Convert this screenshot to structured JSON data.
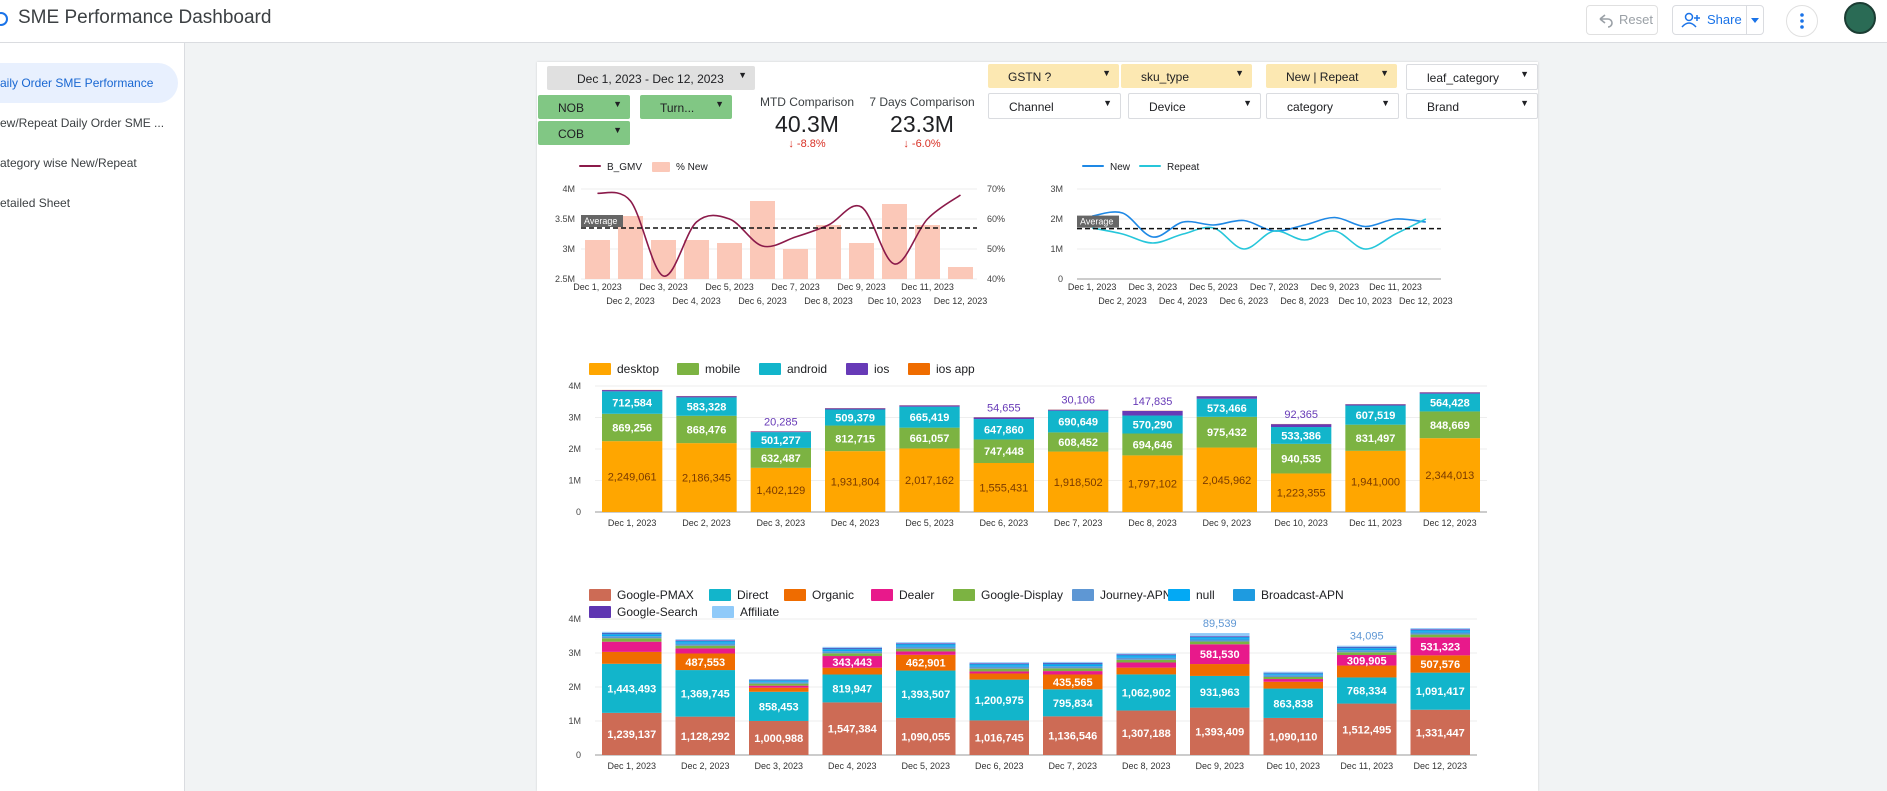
{
  "app": {
    "title": "SME Performance Dashboard",
    "reset_label": "Reset",
    "share_label": "Share"
  },
  "sidebar": {
    "items": [
      {
        "label": "aily Order SME Performance",
        "active": true
      },
      {
        "label": "ew/Repeat Daily Order SME ...",
        "active": false
      },
      {
        "label": "ategory wise New/Repeat",
        "active": false
      },
      {
        "label": "etailed Sheet",
        "active": false
      }
    ]
  },
  "filters": {
    "date_range": "Dec 1, 2023 - Dec 12, 2023",
    "nob": "NOB",
    "turn": "Turn...",
    "cob": "COB",
    "gstn": "GSTN ?",
    "sku_type": "sku_type",
    "new_repeat": "New | Repeat",
    "leaf_category": "leaf_category",
    "channel": "Channel",
    "device": "Device",
    "category": "category",
    "brand": "Brand"
  },
  "kpis": {
    "mtd_label": "MTD Comparison",
    "mtd_value": "40.3M",
    "mtd_delta": "↓ -8.8%",
    "d7_label": "7 Days Comparison",
    "d7_value": "23.3M",
    "d7_delta": "↓ -6.0%"
  },
  "colors": {
    "gmv_line": "#8b1a4a",
    "new_bar": "#fbc8b8",
    "new_line": "#1e88e5",
    "repeat_line": "#26c6da",
    "negative": "#d93025",
    "accent": "#1a73e8"
  },
  "chart_data": [
    {
      "type": "bar",
      "title": "",
      "categories": [
        "Dec 1, 2023",
        "Dec 2, 2023",
        "Dec 3, 2023",
        "Dec 4, 2023",
        "Dec 5, 2023",
        "Dec 6, 2023",
        "Dec 7, 2023",
        "Dec 8, 2023",
        "Dec 9, 2023",
        "Dec 10, 2023",
        "Dec 11, 2023",
        "Dec 12, 2023"
      ],
      "series": [
        {
          "name": "B_GMV",
          "kind": "line",
          "axis": "left",
          "values": [
            3.93,
            3.8,
            2.55,
            3.45,
            3.5,
            3.05,
            3.2,
            3.4,
            3.7,
            2.75,
            3.5,
            3.9
          ]
        },
        {
          "name": "% New",
          "kind": "bar",
          "axis": "right",
          "values": [
            53,
            61,
            53,
            53,
            52,
            66,
            50,
            58,
            52,
            65,
            58,
            44
          ]
        }
      ],
      "annotations": [
        "Average"
      ],
      "ylim_left": [
        2.5,
        4
      ],
      "ylim_right": [
        40,
        70
      ],
      "yticks_left": [
        "2.5M",
        "3M",
        "3.5M",
        "4M"
      ],
      "yticks_right": [
        "40%",
        "50%",
        "60%",
        "70%"
      ],
      "legend": "top-left"
    },
    {
      "type": "line",
      "title": "",
      "categories": [
        "Dec 1, 2023",
        "Dec 2, 2023",
        "Dec 3, 2023",
        "Dec 4, 2023",
        "Dec 5, 2023",
        "Dec 6, 2023",
        "Dec 7, 2023",
        "Dec 8, 2023",
        "Dec 9, 2023",
        "Dec 10, 2023",
        "Dec 11, 2023",
        "Dec 12, 2023"
      ],
      "series": [
        {
          "name": "New",
          "values": [
            2.1,
            2.2,
            1.4,
            1.9,
            1.8,
            1.95,
            1.6,
            1.8,
            2.05,
            1.75,
            2.0,
            1.9
          ]
        },
        {
          "name": "Repeat",
          "values": [
            1.7,
            1.5,
            1.2,
            1.5,
            1.7,
            1.0,
            1.6,
            1.3,
            1.6,
            1.0,
            1.5,
            2.0
          ]
        }
      ],
      "annotations": [
        "Average"
      ],
      "ylim": [
        0,
        3
      ],
      "yticks": [
        "0",
        "1M",
        "2M",
        "3M"
      ],
      "legend": "top-left"
    },
    {
      "type": "bar",
      "stacked": true,
      "title": "",
      "categories": [
        "Dec 1, 2023",
        "Dec 2, 2023",
        "Dec 3, 2023",
        "Dec 4, 2023",
        "Dec 5, 2023",
        "Dec 6, 2023",
        "Dec 7, 2023",
        "Dec 8, 2023",
        "Dec 9, 2023",
        "Dec 10, 2023",
        "Dec 11, 2023",
        "Dec 12, 2023"
      ],
      "series": [
        {
          "name": "desktop",
          "color": "#ffa600",
          "values": [
            2249061,
            2186345,
            1402129,
            1931804,
            2017162,
            1555431,
            1918502,
            1797102,
            2045962,
            1223355,
            1941000,
            2344013
          ]
        },
        {
          "name": "mobile",
          "color": "#7cb342",
          "values": [
            869256,
            868476,
            632487,
            812715,
            661057,
            747448,
            608452,
            694646,
            975432,
            940535,
            831497,
            848669
          ]
        },
        {
          "name": "android",
          "color": "#12b5cb",
          "values": [
            712584,
            583328,
            501277,
            509379,
            665419,
            647860,
            690649,
            570290,
            573466,
            533386,
            607519,
            564428
          ]
        },
        {
          "name": "ios",
          "color": "#673ab7",
          "values": [
            40000,
            40000,
            20285,
            40000,
            40000,
            54655,
            30106,
            147835,
            80000,
            92365,
            40000,
            40000
          ]
        },
        {
          "name": "ios app",
          "color": "#ef6c00",
          "values": [
            5000,
            5000,
            5000,
            5000,
            5000,
            5000,
            5000,
            5000,
            5000,
            5000,
            5000,
            5000
          ]
        }
      ],
      "value_labels": {
        "desktop": [
          "2,249,061",
          "2,186,345",
          "1,402,129",
          "1,931,804",
          "2,017,162",
          "1,555,431",
          "1,918,502",
          "1,797,102",
          "2,045,962",
          "1,223,355",
          "1,941,000",
          "2,344,013"
        ],
        "mobile": [
          "869,256",
          "868,476",
          "632,487",
          "812,715",
          "661,057",
          "747,448",
          "608,452",
          "694,646",
          "975,432",
          "940,535",
          "831,497",
          "848,669"
        ],
        "android": [
          "712,584",
          "583,328",
          "501,277",
          "509,379",
          "665,419",
          "647,860",
          "690,649",
          "570,290",
          "573,466",
          "533,386",
          "607,519",
          "564,428"
        ],
        "ios": [
          "",
          "",
          "20,285",
          "",
          "",
          "54,655",
          "30,106",
          "147,835",
          "",
          "92,365",
          "",
          ""
        ]
      },
      "ylim": [
        0,
        4000000
      ],
      "yticks": [
        "0",
        "1M",
        "2M",
        "3M",
        "4M"
      ],
      "legend": "top"
    },
    {
      "type": "bar",
      "stacked": true,
      "title": "",
      "categories": [
        "Dec 1, 2023",
        "Dec 2, 2023",
        "Dec 3, 2023",
        "Dec 4, 2023",
        "Dec 5, 2023",
        "Dec 6, 2023",
        "Dec 7, 2023",
        "Dec 8, 2023",
        "Dec 9, 2023",
        "Dec 10, 2023",
        "Dec 11, 2023",
        "Dec 12, 2023"
      ],
      "series": [
        {
          "name": "Google-PMAX",
          "color": "#cd6b55",
          "values": [
            1239137,
            1128292,
            1000988,
            1547384,
            1090055,
            1016745,
            1136546,
            1307188,
            1393409,
            1090110,
            1512495,
            1331447
          ]
        },
        {
          "name": "Direct",
          "color": "#12b5cb",
          "values": [
            1443493,
            1369745,
            858453,
            819947,
            1393507,
            1200975,
            795834,
            1062902,
            931963,
            863838,
            768334,
            1091417
          ]
        },
        {
          "name": "Organic",
          "color": "#ef6c00",
          "values": [
            350000,
            487553,
            120000,
            200000,
            462901,
            180000,
            435565,
            200000,
            350000,
            200000,
            350000,
            507576
          ]
        },
        {
          "name": "Dealer",
          "color": "#e8198b",
          "values": [
            300000,
            150000,
            60000,
            343443,
            100000,
            60000,
            100000,
            150000,
            581530,
            80000,
            309905,
            531323
          ]
        },
        {
          "name": "Google-Display",
          "color": "#7cb342",
          "values": [
            100000,
            80000,
            60000,
            80000,
            80000,
            80000,
            80000,
            80000,
            80000,
            60000,
            80000,
            80000
          ]
        },
        {
          "name": "Journey-APN",
          "color": "#5e97d4",
          "values": [
            60000,
            60000,
            40000,
            60000,
            60000,
            60000,
            60000,
            60000,
            60000,
            50000,
            60000,
            60000
          ]
        },
        {
          "name": "null",
          "color": "#03a9f4",
          "values": [
            40000,
            40000,
            30000,
            40000,
            40000,
            40000,
            40000,
            40000,
            40000,
            30000,
            40000,
            40000
          ]
        },
        {
          "name": "Broadcast-APN",
          "color": "#1e9be0",
          "values": [
            40000,
            40000,
            30000,
            40000,
            40000,
            40000,
            40000,
            40000,
            40000,
            30000,
            40000,
            40000
          ]
        },
        {
          "name": "Google-Search",
          "color": "#5e35b1",
          "values": [
            20000,
            20000,
            15000,
            20000,
            20000,
            20000,
            20000,
            20000,
            20000,
            15000,
            20000,
            20000
          ]
        },
        {
          "name": "Affiliate",
          "color": "#90caf9",
          "values": [
            30000,
            30000,
            20000,
            30000,
            30000,
            30000,
            30000,
            30000,
            89539,
            30000,
            34095,
            30000
          ]
        }
      ],
      "value_labels": {
        "Google-PMAX": [
          "1,239,137",
          "1,128,292",
          "1,000,988",
          "1,547,384",
          "1,090,055",
          "1,016,745",
          "1,136,546",
          "1,307,188",
          "1,393,409",
          "1,090,110",
          "1,512,495",
          "1,331,447"
        ],
        "Direct": [
          "1,443,493",
          "1,369,745",
          "858,453",
          "819,947",
          "1,393,507",
          "1,200,975",
          "795,834",
          "1,062,902",
          "931,963",
          "863,838",
          "768,334",
          "1,091,417"
        ],
        "Organic": [
          "",
          "487,553",
          "",
          "",
          "462,901",
          "",
          "435,565",
          "",
          "",
          "",
          "",
          "507,576"
        ],
        "Dealer": [
          "",
          "",
          "",
          "343,443",
          "",
          "",
          "",
          "",
          "581,530",
          "",
          "309,905",
          "531,323"
        ],
        "Affiliate": [
          "",
          "",
          "",
          "",
          "",
          "",
          "",
          "",
          "89,539",
          "",
          "34,095",
          ""
        ]
      },
      "ylim": [
        0,
        4000000
      ],
      "yticks": [
        "0",
        "1M",
        "2M",
        "3M",
        "4M"
      ],
      "legend": "top"
    }
  ]
}
